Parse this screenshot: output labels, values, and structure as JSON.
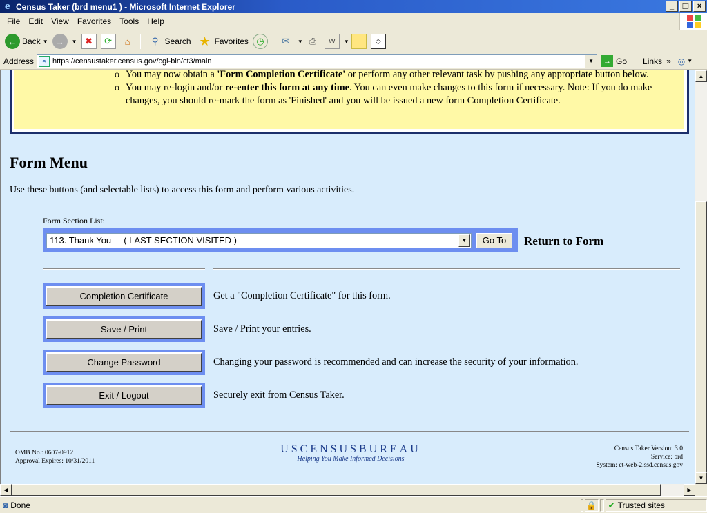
{
  "window": {
    "title": "Census Taker (brd menu1 ) - Microsoft Internet Explorer",
    "controls": [
      "_",
      "❐",
      "×"
    ]
  },
  "menubar": {
    "file": "File",
    "edit": "Edit",
    "view": "View",
    "favorites": "Favorites",
    "tools": "Tools",
    "help": "Help"
  },
  "toolbar": {
    "back": "Back",
    "search": "Search",
    "favorites": "Favorites"
  },
  "addressbar": {
    "label": "Address",
    "url": "https://censustaker.census.gov/cgi-bin/ct3/main",
    "go": "Go",
    "links": "Links"
  },
  "notice": {
    "items": [
      {
        "text": "You may now obtain a ",
        "bold": "'Form Completion Certificate'",
        "rest": " or perform any other relevant task by pushing any appropriate button below."
      },
      {
        "text": "You may re-login and/or ",
        "bold": "re-enter this form at any time",
        "rest": ". You can even make changes to this form if necessary. Note: If you do make changes, you should re-mark the form as 'Finished' and you will be issued a new form Completion Certificate."
      }
    ]
  },
  "form_menu": {
    "title": "Form Menu",
    "intro": "Use these buttons (and selectable lists) to access this form and perform various activities.",
    "section_list_label": "Form Section List:",
    "section_selected": "113. Thank You     ( LAST SECTION VISITED )",
    "goto_label": "Go To",
    "return_label": "Return to Form",
    "actions": [
      {
        "label": "Completion Certificate",
        "desc": "Get a \"Completion Certificate\" for this form."
      },
      {
        "label": "Save / Print",
        "desc": "Save / Print your entries."
      },
      {
        "label": "Change Password",
        "desc": "Changing your password is recommended and can increase the security of your information."
      },
      {
        "label": "Exit / Logout",
        "desc": "Securely exit from Census Taker."
      }
    ]
  },
  "footer": {
    "omb": "OMB No.: 0607-0912",
    "approval": "Approval Expires: 10/31/2011",
    "logo_main": "USCENSUSBUREAU",
    "logo_sub": "Helping You Make Informed Decisions",
    "version": "Census Taker Version: 3.0",
    "service": "Service: brd",
    "system": "System: ct-web-2.ssd.census.gov"
  },
  "status": {
    "done": "Done",
    "zone": "Trusted sites"
  },
  "colors": {
    "page_bg": "#d8ecfc",
    "notice_bg": "#fff9a6",
    "button_frame": "#6d8ef0"
  }
}
